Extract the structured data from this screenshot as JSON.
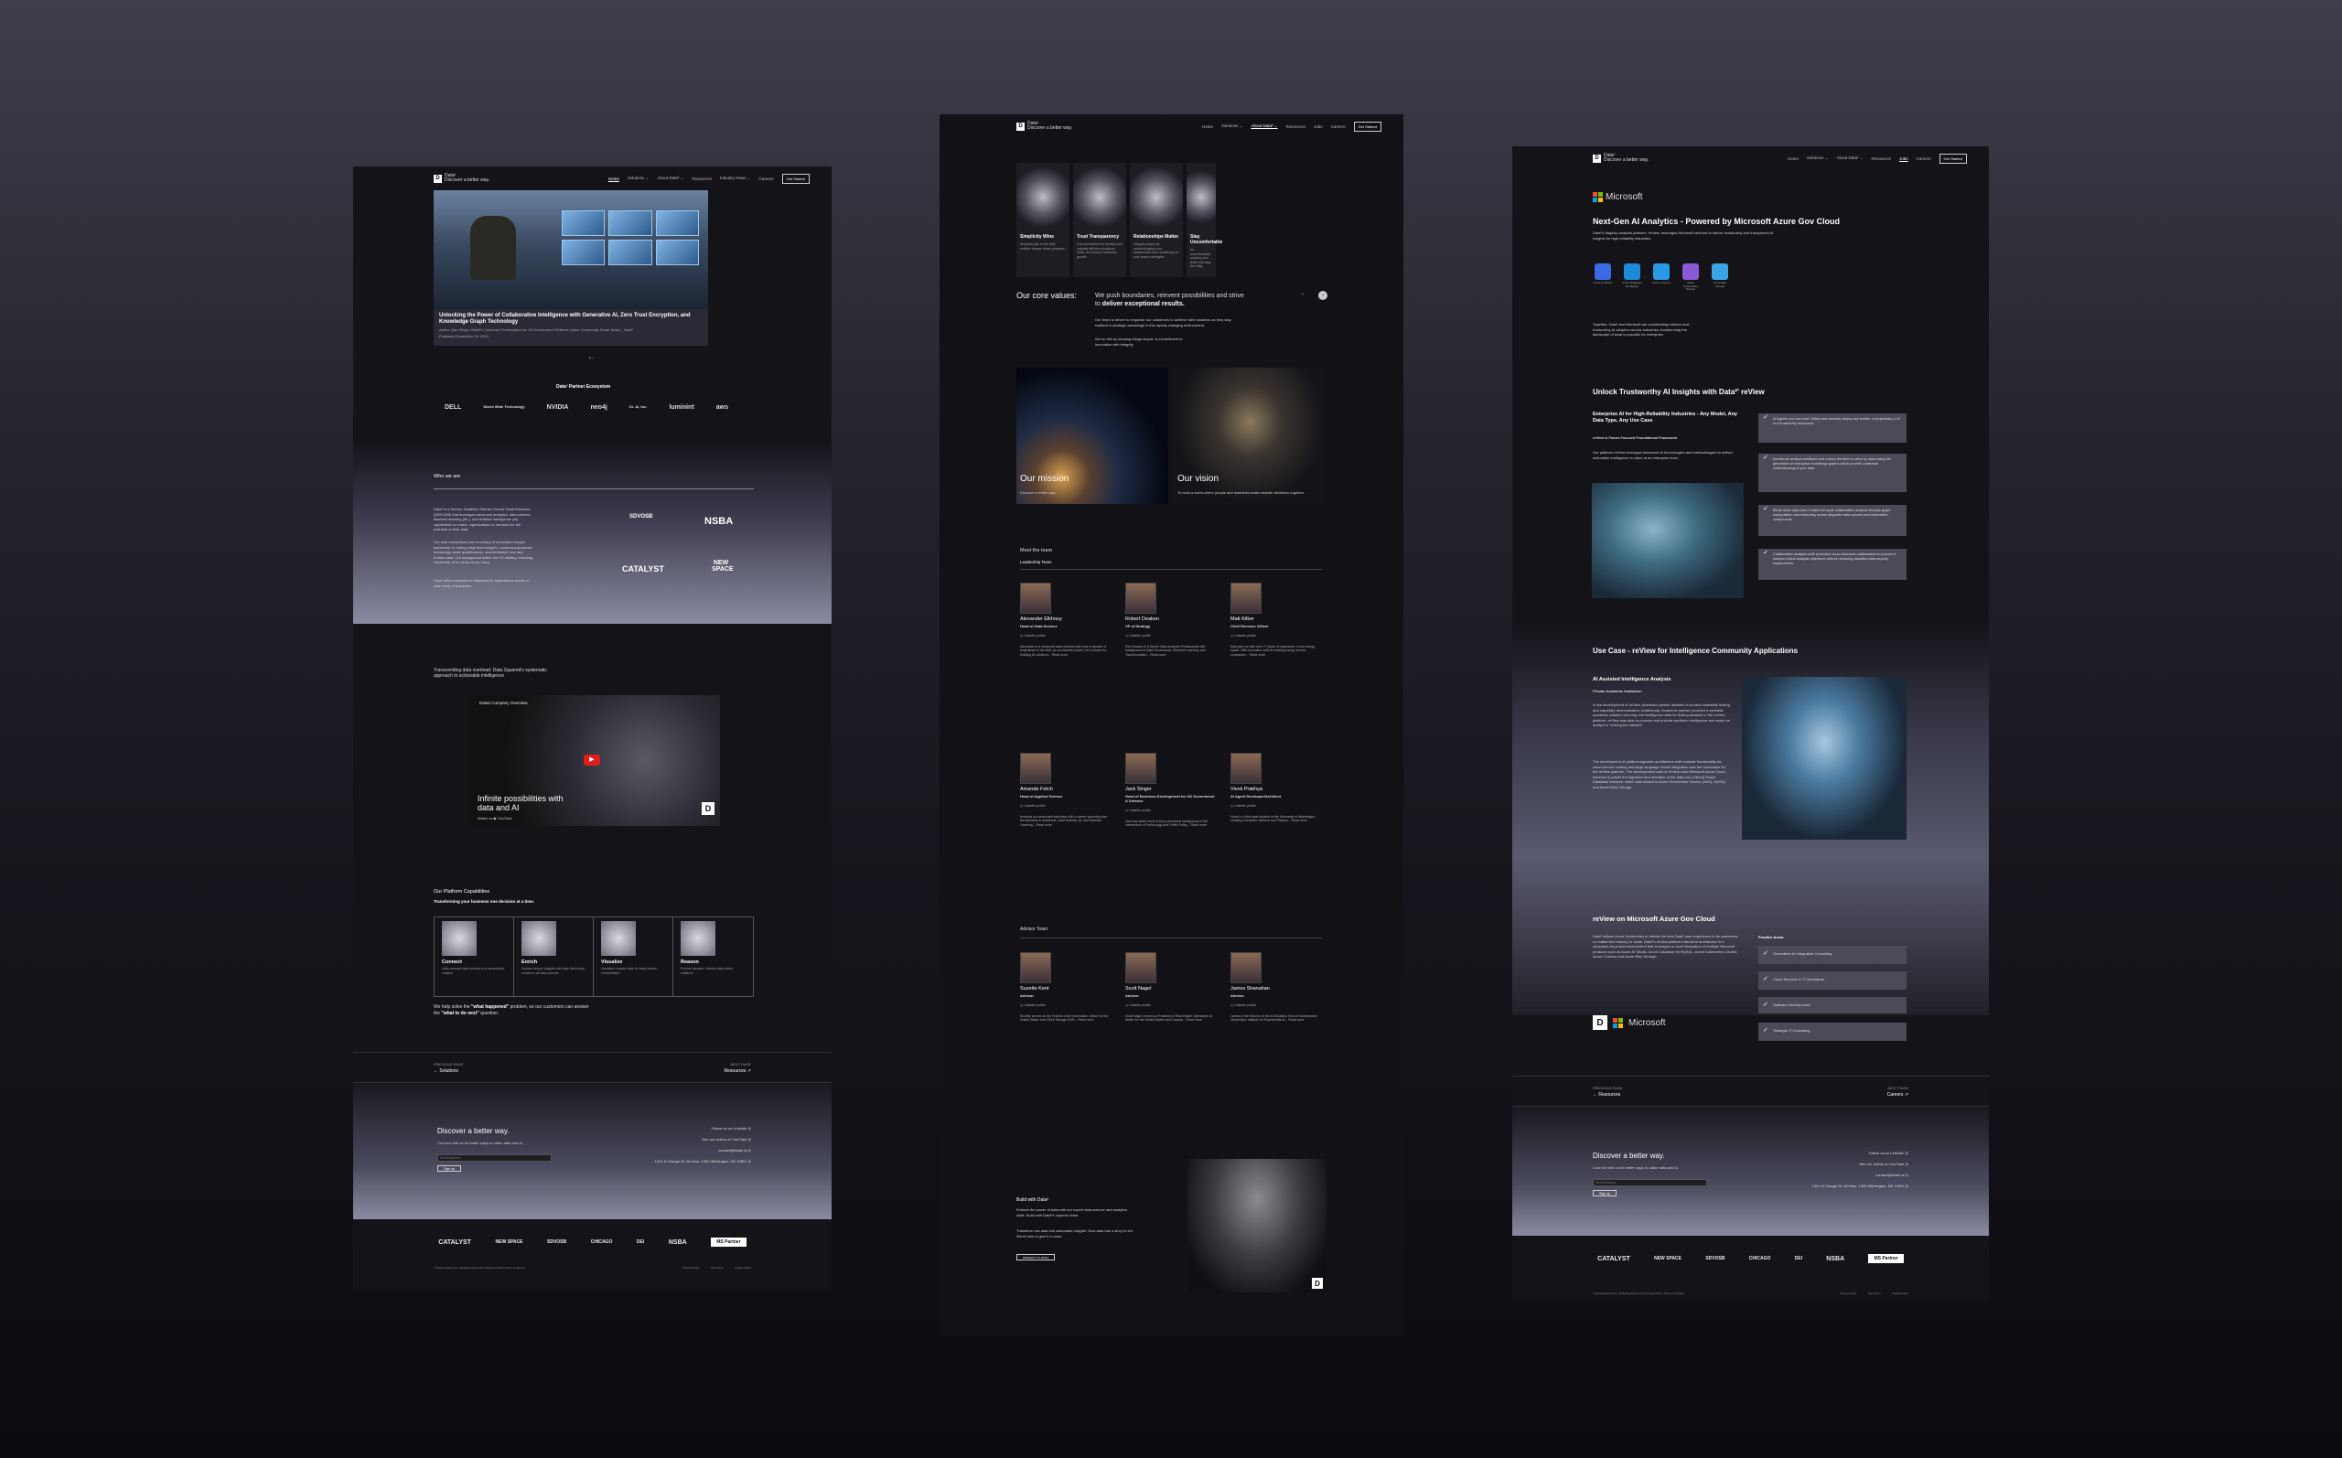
{
  "brand": {
    "name": "Data²",
    "tagline": "Discover a better way.",
    "mark": "D"
  },
  "nav": {
    "p1": [
      "Home",
      "Solutions ⌄",
      "About Data² ⌄",
      "Resources",
      "Industry News ⌄",
      "Careers"
    ],
    "p2": [
      "Home",
      "Solutions ⌄",
      "About Data² ⌄",
      "Resources",
      "Jobs",
      "Careers"
    ],
    "p3": [
      "Home",
      "Solutions ⌄",
      "About Data² ⌄",
      "Resources",
      "Jobs",
      "Careers"
    ],
    "cta": "Get Started"
  },
  "page1": {
    "hero_title": "Unlocking the Power of Collaborative Intelligence with Generative AI, Zero Trust Encryption, and Knowledge Graph Technology",
    "hero_sub": "Author Qao Singh • Data²'s Customer Presentation for US Government Defense Cyber Community Share News – Data²",
    "hero_date": "Published November 13, 2024",
    "partners_title": "Data² Partner Ecosystem",
    "partners": [
      "DELL",
      "World Wide Technology",
      "NVIDIA",
      "neo4j",
      "Dr. AI, Inc.",
      "luminint",
      "aws"
    ],
    "who_title": "Who we are",
    "who_p1": "Data² is a Service Disabled Veteran Owned Small Business (SDVOSB) that leverages advanced analytics, data science, Machine learning (ML), and Artificial Intelligence (AI) capabilities to enable organizations to harness the full potential of their data.",
    "who_p2": "Our team comprises over a century of combined thought leadership in cutting-edge technologies, consensus-powered, knowledge-scale qualifications, and dedicated new and trusted data. Our background within the US military, including leadership of AI, Army, Army, Navy.",
    "who_p3": "Data² offers expertise in deploying AI applications across a wide array of industries.",
    "who_logos": [
      "SDVOSB",
      "NSBA",
      "CATALYST",
      "NEW SPACE"
    ],
    "video_heading": "Transcending data overload: Data Squared's systematic approach to actionable intelligence",
    "video_channel": "Data2 Company Overview",
    "video_title": "Infinite possibilities with data and AI",
    "video_watch": "Watch on ▶ YouTube",
    "cap_title": "Our Platform Capabilities",
    "cap_sub": "Transforming your business one decision at a time.",
    "caps": [
      {
        "title": "Connect",
        "desc": "Unify relevant data sources to a streamlined solution"
      },
      {
        "title": "Enrich",
        "desc": "Surface deeper insights with data that brings context to all data sources"
      },
      {
        "title": "Visualize",
        "desc": "Visualize complex data for easy human interpretation"
      },
      {
        "title": "Reason",
        "desc": "Provide dynamic, flexible data-driven solutions"
      }
    ],
    "cap_note_a": "We help solve the ",
    "cap_note_b": "\"what happened\"",
    "cap_note_c": " problem, so our customers can answer the ",
    "cap_note_d": "\"what to do next\"",
    "cap_note_e": " question.",
    "prev_label": "PREVIOUS PAGE",
    "prev_link": "← Solutions",
    "next_label": "NEXT PAGE",
    "next_link": "Resources ↗"
  },
  "page2": {
    "values": [
      {
        "title": "Simplicity Wins",
        "desc": "Simplest path to the best solution always drives progress."
      },
      {
        "title": "Trust Transparency",
        "desc": "Our commitment to honesty and integrity will drive customer value, and product maturing growth."
      },
      {
        "title": "Relationships Matter",
        "desc": "Integrity begins by acknowledging your weaknesses and capitalizing on your team's strengths."
      },
      {
        "title": "Stay Uncomfortable",
        "desc": "An uncomfortable pushing your limits reaching the edge"
      }
    ],
    "core_label": "Our core values:",
    "core_text_a": "We push boundaries, reinvent possibilities and strive to ",
    "core_text_b": "deliver exceptional results.",
    "core_p1": "Our team is driven to empower our customers to achieve their business as they stay resilient in strategic advantage in this rapidly changing environment.",
    "core_p2": "We do this by keeping things simple. A commitment to innovation with integrity.",
    "mission_title": "Our mission",
    "mission_desc": "Discover a better way.",
    "vision_title": "Our vision",
    "vision_desc": "To build a world where people and machines make smarter decisions together.",
    "meet": "Meet the team",
    "leadership": "Leadership Team",
    "leaders": [
      {
        "name": "Alexander Elkhouy",
        "role": "Head of Data Science",
        "bio": "Alexander is a seasoned data scientist with over a decade of experience in the field. As an industry expert, he is known for building AI solutions... Read more"
      },
      {
        "name": "Robert Deakon",
        "role": "VP of Strategy",
        "bio": "Rob Deakon is a Senior Data Analyst's Professional with background in Data Governance, Machine Learning, and Transformation... Read more"
      },
      {
        "name": "Matt Kilker",
        "role": "Chief Revenue Officer",
        "bio": "Matt joins us with over 17 years of experience in the energy space. With executive roles in leading energy service companies... Read more"
      },
      {
        "name": "Amanda Fetch",
        "role": "Head of Applied Science",
        "bio": "Amanda is a seasoned executive with a career spanning over two decades in academia, Data Science, AI, and Machine Learning... Read more"
      },
      {
        "name": "Jack Singer",
        "role": "Head of Business Development for US Government & Defense",
        "bio": "Jack has spent most of his professional background in the intersection of Technology and Public Policy... Read more"
      },
      {
        "name": "Vivek Prakhya",
        "role": "AI Agent Developer/Architect",
        "bio": "Vivek is a third-year student at the University of Washington, studying Computer Science and Physics... Read more"
      }
    ],
    "advisor": "Advisor Team",
    "advisors": [
      {
        "name": "Suzette Kent",
        "role": "Advisor",
        "bio": "Suzette served as the Federal Chief Information Officer for the United States from 2018 through 2020... Read more"
      },
      {
        "name": "Scott Nagel",
        "role": "Advisor",
        "bio": "Scott Nagel served as President of Real Estate Operations at Netflix for the United States and Canada... Read more"
      },
      {
        "name": "James Shanahan",
        "role": "Advisor",
        "bio": "James is the Director of the AI Solutions Hub at Northwestern University's Institute for Experiential AI... Read more"
      }
    ],
    "linkedin": "LinkedIn profile",
    "build_title": "Build with Data²",
    "build_p1": "Embark the power of data with our expert data science and analytics skills. Build with Data²'s superior team.",
    "build_p2": "Transform raw data into actionable insights. Now data has a story to tell. We're here to give it a voice.",
    "build_btn": "PRESENT TO DATA²"
  },
  "page3": {
    "ms": "Microsoft",
    "title": "Next-Gen AI Analytics - Powered by Microsoft Azure Gov Cloud",
    "intro": "Data²'s flagship analysis platform, reView, leverages Microsoft services to deliver trustworthy and transparent AI insights for high-reliability industries.",
    "azure": [
      {
        "label": "Azure AI Studio",
        "color": "#3a6ae6"
      },
      {
        "label": "Azure Database for MySQL",
        "color": "#1c8ad6"
      },
      {
        "label": "Azure Cosmos",
        "color": "#2a9ae6"
      },
      {
        "label": "Azure Kubernetes Service",
        "color": "#8a5ad6"
      },
      {
        "label": "Azure Blob Storage",
        "color": "#3aa6e6"
      }
    ],
    "together": "Together, Data² and Microsoft are accelerating reliance and trustworthy AI adoption across industries, transforming the landscape of what is possible for enterprise.",
    "unlock": "Unlock Trustworthy AI Insights with Data²' reView",
    "ent_title": "Enterprise AI for High-Reliability Industries - Any Model, Any Data Type, Any Use Case",
    "ent_sub": "reView is Future-Focused Foundational Framework",
    "ent_p": "Our platform reView leverages advanced AI technologies and methodologies to deliver actionable intelligence to value at an enterprise level.",
    "checks": [
      "AI Agents you can trust: Safely and securely deploy any frontier or proprietary LLM in a trustworthy framework.",
      "Accelerate analyst workflows and reduce the time to value by automating the generation of interactive knowledge graphs which provide contextual understanding of your data.",
      "Break down data silos: Enable full cycle collaborative analysis through graph manipulation and reasoning across disparate data sources and information components.",
      "Collaborative analysis suite promotes cross-clearance collaboration in pursuit of mission critical analysis objectives without releasing classified data security requirements."
    ],
    "usecase": "Use Case - reView for Intelligence Community Applications",
    "ai_title": "AI Assisted Intelligence Analysis",
    "ai_sub": "Private Academic Institution",
    "uc_p1": "In the development of reView, Academic partner assisted in product feasibility testing and capability demonstration. Additionally, Academic partner provided a synthetic academic dataset mirroring real intelligence data for testing analysis in the reView platform. reView was able to process and provide synthetic intelligence and assist an analyst in \"solving the dataset\".",
    "uc_p2": "The development of platform agnostic architecture with modular functionality for cloud service hosting and large language model integration was the foundation for the reView platform. The development build of reView used Microsoft Azure Cloud services to power the ingestion and retention of the data into a Neo4j Graph Database instance, which was hosted in Azure Kubernetes Service (AKS), MySQL and Azure Blob Storage.",
    "gov_title": "reView on Microsoft Azure Gov Cloud",
    "gov_p": "Data² utilizes Azure Kubernetes to deliver the best SaaS user experience to its customers, no matter the industry or scale. Data²'s reView platform has been architected in a compliant cloud and environment that leverages a novel integration of multiple Microsoft products such as Azure AI Studio, Azure Database for MySQL, Azure Kubernetes Cluster, Azure Cosmos and Azure Blob Storage.",
    "practice": "Practice Areas",
    "areas": [
      "Generative AI Integration Consulting",
      "Cloud Services & IT Operations",
      "Software Development",
      "Strategic IT Consulting"
    ],
    "prev_link": "← Resources",
    "next_link": "Careers ↗"
  },
  "footer": {
    "discover": "Discover a better way.",
    "connect": "Connect with us for better ways to utilize data and AI.",
    "email_ph": "Email Address",
    "signup": "Sign up",
    "links": [
      "Follow us on LinkedIn",
      "See our videos on YouTube",
      "contact@data2.ai",
      "1321 N Orange St, 4th floor, 1450 Wilmington, DE 19801"
    ],
    "logos": [
      "CATALYST",
      "NEW SPACE",
      "SDVOSB",
      "CHICAGO",
      "DEI",
      "NSBA",
      "MS Partner"
    ],
    "copyright": "© Data Squared Inc. All Rights Reserved | Privacy Policy | Terms of Service",
    "legal": [
      "Privacy Policy",
      "Site Terms",
      "Cookie Policy"
    ]
  },
  "colors": {
    "accent": "#ffffff",
    "ms_red": "#f25022",
    "ms_green": "#7fba00",
    "ms_blue": "#00a4ef",
    "ms_yellow": "#ffb900",
    "yt_red": "#e01c1c"
  }
}
